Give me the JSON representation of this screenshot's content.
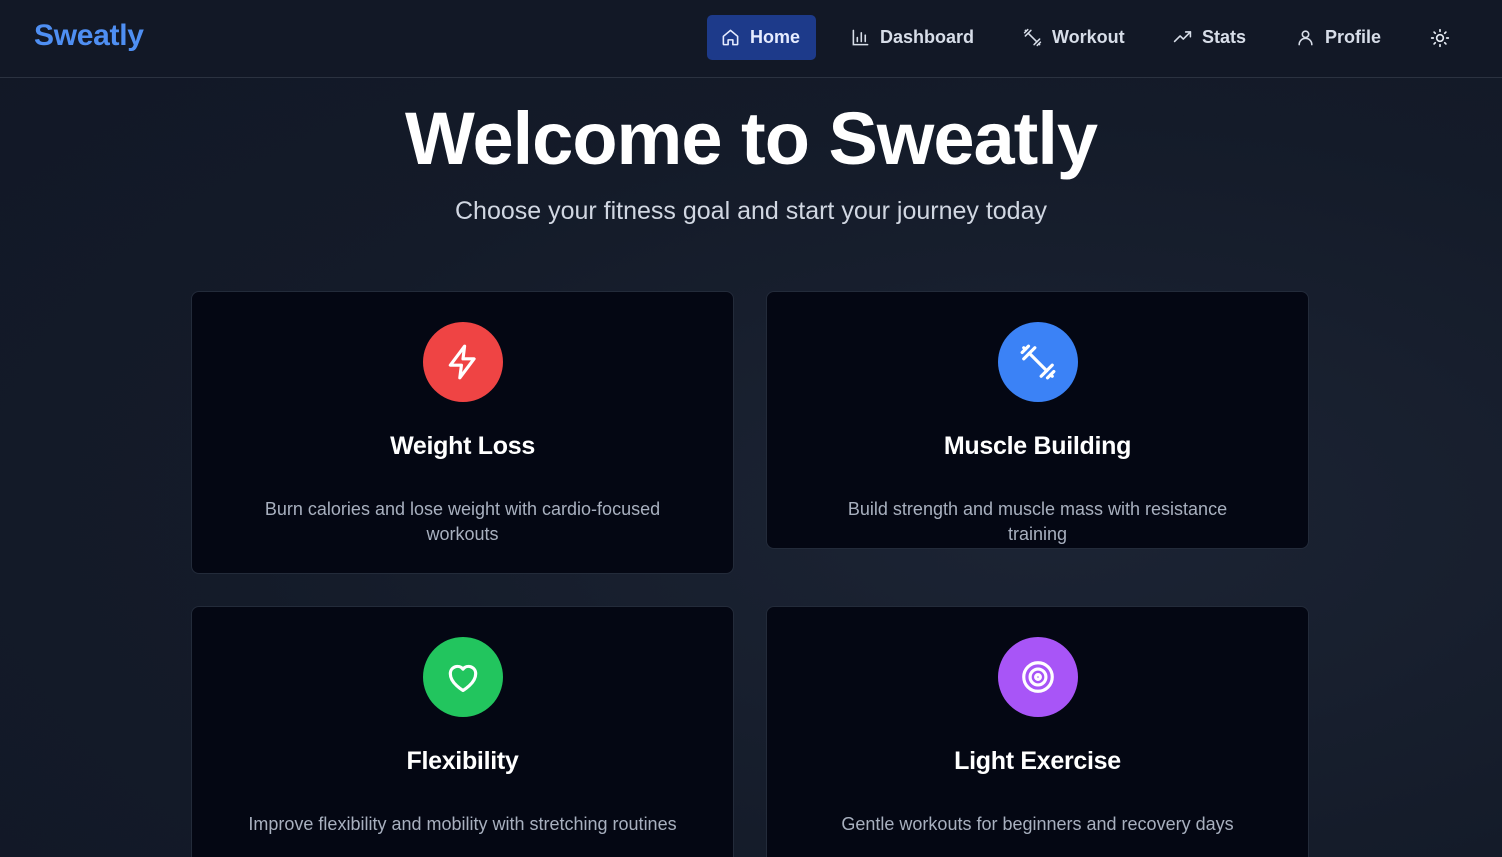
{
  "brand": "Sweatly",
  "nav": {
    "items": [
      {
        "label": "Home",
        "icon": "home-icon",
        "active": true
      },
      {
        "label": "Dashboard",
        "icon": "bar-chart-icon",
        "active": false
      },
      {
        "label": "Workout",
        "icon": "dumbbell-icon",
        "active": false
      },
      {
        "label": "Stats",
        "icon": "trending-up-icon",
        "active": false
      },
      {
        "label": "Profile",
        "icon": "user-icon",
        "active": false
      }
    ],
    "theme_toggle_icon": "sun-icon"
  },
  "hero": {
    "title": "Welcome to Sweatly",
    "subtitle": "Choose your fitness goal and start your journey today"
  },
  "goals": [
    {
      "title": "Weight Loss",
      "description": "Burn calories and lose weight with cardio-focused workouts",
      "icon": "lightning-icon",
      "color": "#ef4444"
    },
    {
      "title": "Muscle Building",
      "description": "Build strength and muscle mass with resistance training",
      "icon": "dumbbell-icon",
      "color": "#3b82f6"
    },
    {
      "title": "Flexibility",
      "description": "Improve flexibility and mobility with stretching routines",
      "icon": "heart-icon",
      "color": "#22c55e"
    },
    {
      "title": "Light Exercise",
      "description": "Gentle workouts for beginners and recovery days",
      "icon": "target-icon",
      "color": "#a855f7"
    }
  ],
  "colors": {
    "brand": "#4f8ff3",
    "nav_active_bg": "#1d3a8a",
    "card_bg": "#040713",
    "page_bg": "#141b29"
  }
}
